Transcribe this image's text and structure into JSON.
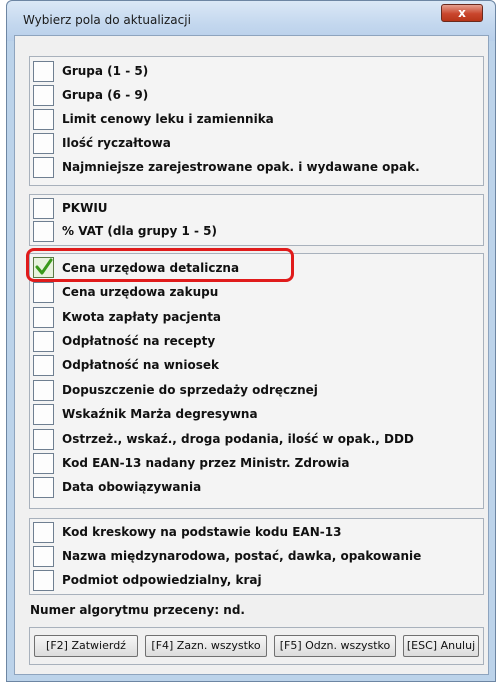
{
  "window": {
    "title": "Wybierz pola do aktualizacji",
    "close_label": "x"
  },
  "groups": [
    {
      "items": [
        {
          "label": "Grupa (1 - 5)",
          "checked": false
        },
        {
          "label": "Grupa (6 - 9)",
          "checked": false
        },
        {
          "label": "Limit cenowy leku i zamiennika",
          "checked": false
        },
        {
          "label": "Ilość ryczałtowa",
          "checked": false
        },
        {
          "label": "Najmniejsze zarejestrowane opak. i wydawane opak.",
          "checked": false
        }
      ]
    },
    {
      "items": [
        {
          "label": "PKWIU",
          "checked": false
        },
        {
          "label": "% VAT (dla grupy 1 - 5)",
          "checked": false
        }
      ]
    },
    {
      "items": [
        {
          "label": "Cena urzędowa detaliczna",
          "checked": true
        },
        {
          "label": "Cena urzędowa zakupu",
          "checked": false
        },
        {
          "label": "Kwota zapłaty pacjenta",
          "checked": false
        },
        {
          "label": "Odpłatność na recepty",
          "checked": false
        },
        {
          "label": "Odpłatność na wniosek",
          "checked": false
        },
        {
          "label": "Dopuszczenie do sprzedaży odręcznej",
          "checked": false
        },
        {
          "label": "Wskaźnik Marża degresywna",
          "checked": false
        },
        {
          "label": "Ostrzeż., wskaź., droga podania, ilość w opak., DDD",
          "checked": false
        },
        {
          "label": "Kod EAN-13 nadany przez Ministr. Zdrowia",
          "checked": false
        },
        {
          "label": "Data obowiązywania",
          "checked": false
        }
      ]
    },
    {
      "items": [
        {
          "label": "Kod kreskowy na podstawie kodu EAN-13",
          "checked": false
        },
        {
          "label": "Nazwa międzynarodowa, postać, dawka, opakowanie",
          "checked": false
        },
        {
          "label": "Podmiot odpowiedzialny, kraj",
          "checked": false
        }
      ]
    }
  ],
  "algorithm_text": "Numer algorytmu przeceny: nd.",
  "buttons": {
    "confirm": "[F2] Zatwierdź",
    "select_all": "[F4] Zazn. wszystko",
    "deselect_all": "[F5] Odzn. wszystko",
    "cancel": "[ESC] Anuluj"
  },
  "colors": {
    "highlight": "#e01b1b",
    "check": "#3a9a1a"
  }
}
